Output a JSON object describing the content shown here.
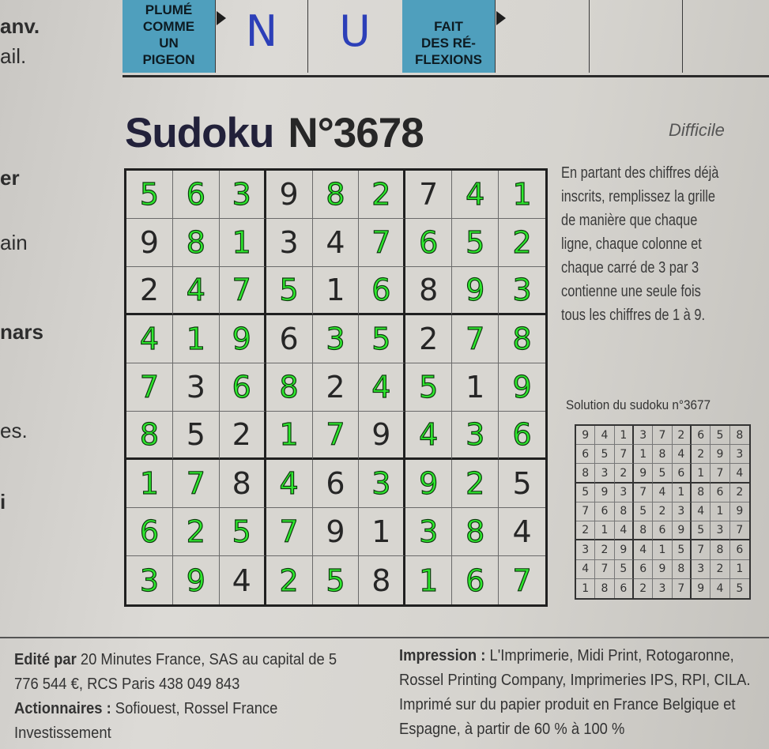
{
  "crossword": {
    "clue1": [
      "PLUMÉ",
      "COMME",
      "UN",
      "PIGEON"
    ],
    "letter1": "N",
    "letter2": "U",
    "clue2": [
      "FAIT",
      "DES RÉ-",
      "FLEXIONS"
    ]
  },
  "left_fragments": [
    "anv.",
    "ail.",
    "er",
    "ain",
    "nars",
    "es.",
    "i"
  ],
  "title": "Sudoku",
  "number": "N°3678",
  "difficulty": "Difficile",
  "instructions": "En partant des chiffres déjà inscrits, remplissez la grille de manière que chaque ligne, chaque colonne et chaque carré de 3 par 3 contienne une seule fois tous les chiffres de 1 à 9.",
  "puzzle": {
    "rows": [
      [
        5,
        6,
        3,
        9,
        8,
        2,
        7,
        4,
        1
      ],
      [
        9,
        8,
        1,
        3,
        4,
        7,
        6,
        5,
        2
      ],
      [
        2,
        4,
        7,
        5,
        1,
        6,
        8,
        9,
        3
      ],
      [
        4,
        1,
        9,
        6,
        3,
        5,
        2,
        7,
        8
      ],
      [
        7,
        3,
        6,
        8,
        2,
        4,
        5,
        1,
        9
      ],
      [
        8,
        5,
        2,
        1,
        7,
        9,
        4,
        3,
        6
      ],
      [
        1,
        7,
        8,
        4,
        6,
        3,
        9,
        2,
        5
      ],
      [
        6,
        2,
        5,
        7,
        9,
        1,
        3,
        8,
        4
      ],
      [
        3,
        9,
        4,
        2,
        5,
        8,
        1,
        6,
        7
      ]
    ],
    "given": [
      [
        0,
        0,
        0,
        1,
        0,
        0,
        1,
        0,
        0
      ],
      [
        1,
        0,
        0,
        1,
        1,
        0,
        0,
        0,
        0
      ],
      [
        1,
        0,
        0,
        0,
        1,
        0,
        1,
        0,
        0
      ],
      [
        0,
        0,
        0,
        1,
        0,
        0,
        1,
        0,
        0
      ],
      [
        0,
        1,
        0,
        0,
        1,
        0,
        0,
        1,
        0
      ],
      [
        0,
        1,
        1,
        0,
        0,
        1,
        0,
        0,
        0
      ],
      [
        0,
        0,
        1,
        0,
        1,
        0,
        0,
        0,
        1
      ],
      [
        0,
        0,
        0,
        0,
        1,
        1,
        0,
        0,
        1
      ],
      [
        0,
        0,
        1,
        0,
        0,
        1,
        0,
        0,
        0
      ]
    ],
    "colors": {
      "given": "#262626",
      "filled": "#2ee82e"
    }
  },
  "solution_title": "Solution du sudoku n°3677",
  "solution": [
    [
      9,
      4,
      1,
      3,
      7,
      2,
      6,
      5,
      8
    ],
    [
      6,
      5,
      7,
      1,
      8,
      4,
      2,
      9,
      3
    ],
    [
      8,
      3,
      2,
      9,
      5,
      6,
      1,
      7,
      4
    ],
    [
      5,
      9,
      3,
      7,
      4,
      1,
      8,
      6,
      2
    ],
    [
      7,
      6,
      8,
      5,
      2,
      3,
      4,
      1,
      9
    ],
    [
      2,
      1,
      4,
      8,
      6,
      9,
      5,
      3,
      7
    ],
    [
      3,
      2,
      9,
      4,
      1,
      5,
      7,
      8,
      6
    ],
    [
      4,
      7,
      5,
      6,
      9,
      8,
      3,
      2,
      1
    ],
    [
      1,
      8,
      6,
      2,
      3,
      7,
      9,
      4,
      5
    ]
  ],
  "footer": {
    "edited_label": "Edité par",
    "edited_text": " 20 Minutes France, SAS au capital de 5 776 544 €, RCS Paris 438 049 843",
    "shareholders_label": "Actionnaires :",
    "shareholders_text": " Sofiouest, Rossel France Investissement",
    "printing_label": "Impression :",
    "printing_text": " L'Imprimerie, Midi Print, Rotogaronne, Rossel Printing Company, Imprimeries IPS, RPI, CILA. Imprimé sur du papier produit en France Belgique et Espagne, à partir de 60 % à 100 %"
  }
}
